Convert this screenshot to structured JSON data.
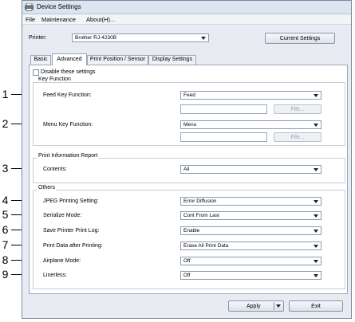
{
  "window": {
    "title": "Device Settings"
  },
  "menu": {
    "file": "File",
    "maintenance": "Maintenance",
    "about": "About(H)..."
  },
  "printer": {
    "label": "Printer:",
    "value": "Brother RJ-4230B",
    "current_settings": "Current Settings"
  },
  "tabs": [
    "Basic",
    "Advanced",
    "Print Position / Sensor",
    "Display Settings"
  ],
  "disable_label": "Disable these settings",
  "key_function": {
    "title": "Key Function",
    "feed_label": "Feed Key Function:",
    "feed_value": "Feed",
    "menu_label": "Menu Key Function:",
    "menu_value": "Menu",
    "file_button": "File..."
  },
  "print_info": {
    "title": "Print Information Report",
    "contents_label": "Contents:",
    "contents_value": "All"
  },
  "others": {
    "title": "Others",
    "rows": [
      {
        "label": "JPEG Printing Setting:",
        "value": "Error Diffusion"
      },
      {
        "label": "Serialize Mode:",
        "value": "Cont From Last"
      },
      {
        "label": "Save Printer Print Log:",
        "value": "Enable"
      },
      {
        "label": "Print Data after Printing:",
        "value": "Erase All Print Data"
      },
      {
        "label": "Airplane Mode:",
        "value": "Off"
      },
      {
        "label": "Linerless:",
        "value": "Off"
      }
    ]
  },
  "buttons": {
    "apply": "Apply",
    "exit": "Exit"
  },
  "callouts": [
    "1",
    "2",
    "3",
    "4",
    "5",
    "6",
    "7",
    "8",
    "9"
  ]
}
